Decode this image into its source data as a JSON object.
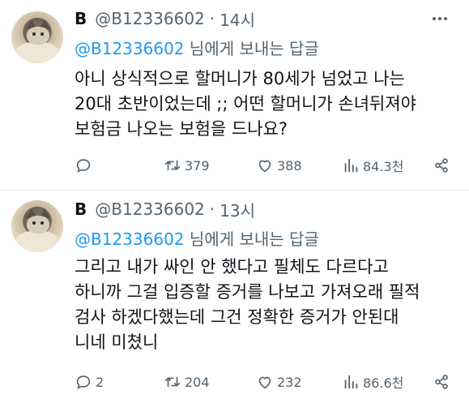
{
  "tweets": [
    {
      "display_name": "B",
      "handle": "@B12336602",
      "separator": "·",
      "time": "14시",
      "reply_to": "@B12336602",
      "reply_suffix": "님에게 보내는 답글",
      "text_lines": [
        "아니 상식적으로 할머니가 80세가 넘었고 나는",
        "20대 초반이었는데 ;; 어떤 할머니가 손녀뒤져야",
        "보험금 나오는 보험을 드나요?"
      ],
      "replies": "",
      "retweets": "379",
      "likes": "388",
      "views": "84.3천"
    },
    {
      "display_name": "B",
      "handle": "@B12336602",
      "separator": "·",
      "time": "13시",
      "reply_to": "@B12336602",
      "reply_suffix": "님에게 보내는 답글",
      "text_lines": [
        "그리고 내가 싸인 안 했다고 필체도 다르다고",
        "하니까 그걸 입증할 증거를 나보고 가져오래 필적",
        "검사 하겠다했는데 그건 정확한 증거가 안된대",
        "니네 미쳤니"
      ],
      "replies": "2",
      "retweets": "204",
      "likes": "232",
      "views": "86.6천"
    }
  ],
  "icons": {
    "more": "more-dots-icon",
    "reply": "reply-bubble-icon",
    "retweet": "retweet-icon",
    "like": "heart-icon",
    "views": "views-bar-chart-icon",
    "share": "share-icon"
  },
  "colors": {
    "text": "#0f1419",
    "secondary": "#536471",
    "accent": "#1d9bf0",
    "divider": "#e7e9ea"
  }
}
